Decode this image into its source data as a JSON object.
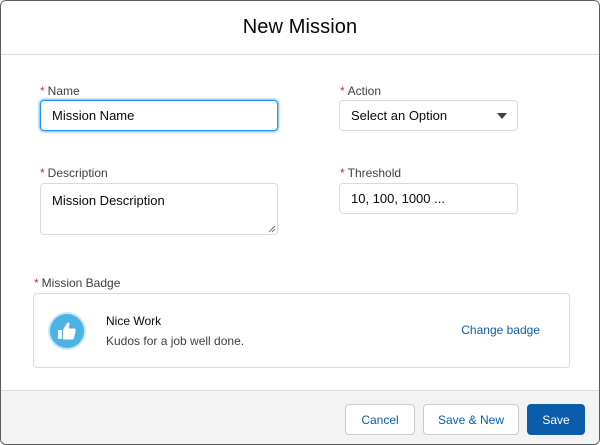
{
  "modal": {
    "title": "New Mission"
  },
  "form": {
    "required_marker": "*",
    "name": {
      "label": "Name",
      "value": "Mission Name"
    },
    "action": {
      "label": "Action",
      "value": "Select an Option"
    },
    "description": {
      "label": "Description",
      "value": "Mission Description"
    },
    "threshold": {
      "label": "Threshold",
      "value": "10, 100, 1000 ..."
    },
    "badge": {
      "label": "Mission Badge",
      "name": "Nice Work",
      "description": "Kudos for a job well done.",
      "change_label": "Change badge",
      "icon": "thumbs-up-icon"
    }
  },
  "footer": {
    "cancel_label": "Cancel",
    "save_new_label": "Save & New",
    "save_label": "Save"
  },
  "colors": {
    "brand": "#0b5cab",
    "required": "#c23934",
    "focus": "#1b96ff",
    "badge_bg": "#4bb3e6"
  }
}
